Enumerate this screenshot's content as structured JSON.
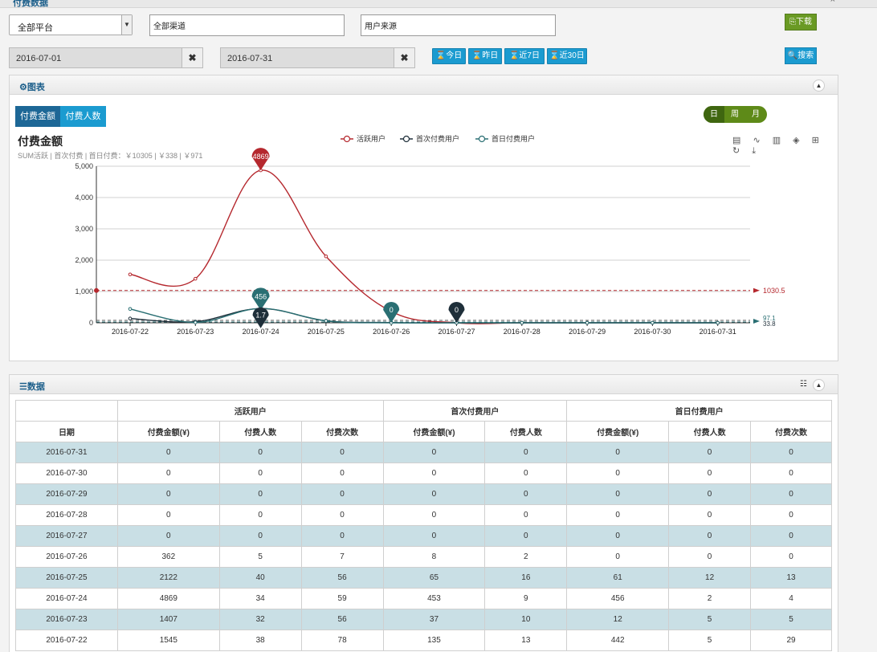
{
  "window": {
    "title": "付费数据",
    "close_glyph": "×"
  },
  "filters": {
    "platform": {
      "value": "全部平台",
      "options": [
        "全部平台"
      ]
    },
    "channel": {
      "value": "全部渠道"
    },
    "source": {
      "value": "用户来源"
    },
    "start_date": "2016-07-01",
    "end_date": "2016-07-31",
    "clear_glyph": "✖",
    "quick": [
      {
        "label": "⌛今日"
      },
      {
        "label": "⌛昨日"
      },
      {
        "label": "⌛近7日"
      },
      {
        "label": "⌛近30日"
      }
    ],
    "download": "⎘下载",
    "search": "🔍搜索"
  },
  "chart_panel": {
    "title": "⚙图表",
    "collapse_glyph": "▲",
    "tabs": [
      {
        "label": "付费金额",
        "active": true
      },
      {
        "label": "付费人数",
        "active": false
      }
    ],
    "granularity": [
      {
        "label": "日",
        "active": true
      },
      {
        "label": "周",
        "active": false
      },
      {
        "label": "月",
        "active": false
      }
    ],
    "heading": "付费金额",
    "subtitle": "SUM活跃 | 首次付费 | 首日付费：￥10305 | ￥338 | ￥971",
    "toolbox_icons": [
      "data-view-icon",
      "line-icon",
      "bar-icon",
      "stack-icon",
      "tiled-icon",
      "refresh-icon",
      "download-icon"
    ],
    "toolbox_glyphs": "▤ ∿ ▥ ◈ ⊞ ↻ ⤓"
  },
  "chart_data": {
    "type": "line",
    "categories": [
      "2016-07-22",
      "2016-07-23",
      "2016-07-24",
      "2016-07-25",
      "2016-07-26",
      "2016-07-27",
      "2016-07-28",
      "2016-07-29",
      "2016-07-30",
      "2016-07-31"
    ],
    "ylim": [
      0,
      5000
    ],
    "yticks": [
      0,
      1000,
      2000,
      3000,
      4000,
      5000
    ],
    "ytick_labels": [
      "0",
      "1,000",
      "2,000",
      "3,000",
      "4,000",
      "5,000"
    ],
    "series": [
      {
        "name": "活跃用户",
        "color": "#b5282e",
        "values": [
          1545,
          1407,
          4869,
          2122,
          362,
          0,
          0,
          0,
          0,
          0
        ],
        "mark_max": "4869",
        "avg_line": 1030.5,
        "avg_label": "1030.5"
      },
      {
        "name": "首次付费用户",
        "color": "#1f2f3a",
        "values": [
          135,
          37,
          453,
          65,
          8,
          0,
          0,
          0,
          0,
          0
        ],
        "mark_label": "1.7",
        "mark_min": "0",
        "avg_label": "33.8"
      },
      {
        "name": "首日付费用户",
        "color": "#2a6f73",
        "values": [
          442,
          12,
          456,
          61,
          0,
          0,
          0,
          0,
          0,
          0
        ],
        "mark_max": "456",
        "mark_min": "0",
        "avg_label": "97.1"
      }
    ]
  },
  "data_panel": {
    "title": "☰数据",
    "list_glyph": "☷",
    "collapse_glyph": "▲",
    "group_headers": [
      "活跃用户",
      "首次付费用户",
      "首日付费用户"
    ],
    "columns": [
      "日期",
      "付费金额(¥)",
      "付费人数",
      "付费次数",
      "付费金额(¥)",
      "付费人数",
      "付费金额(¥)",
      "付费人数",
      "付费次数"
    ],
    "rows": [
      [
        "2016-07-31",
        "0",
        "0",
        "0",
        "0",
        "0",
        "0",
        "0",
        "0"
      ],
      [
        "2016-07-30",
        "0",
        "0",
        "0",
        "0",
        "0",
        "0",
        "0",
        "0"
      ],
      [
        "2016-07-29",
        "0",
        "0",
        "0",
        "0",
        "0",
        "0",
        "0",
        "0"
      ],
      [
        "2016-07-28",
        "0",
        "0",
        "0",
        "0",
        "0",
        "0",
        "0",
        "0"
      ],
      [
        "2016-07-27",
        "0",
        "0",
        "0",
        "0",
        "0",
        "0",
        "0",
        "0"
      ],
      [
        "2016-07-26",
        "362",
        "5",
        "7",
        "8",
        "2",
        "0",
        "0",
        "0"
      ],
      [
        "2016-07-25",
        "2122",
        "40",
        "56",
        "65",
        "16",
        "61",
        "12",
        "13"
      ],
      [
        "2016-07-24",
        "4869",
        "34",
        "59",
        "453",
        "9",
        "456",
        "2",
        "4"
      ],
      [
        "2016-07-23",
        "1407",
        "32",
        "56",
        "37",
        "10",
        "12",
        "5",
        "5"
      ],
      [
        "2016-07-22",
        "1545",
        "38",
        "78",
        "135",
        "13",
        "442",
        "5",
        "29"
      ]
    ]
  }
}
